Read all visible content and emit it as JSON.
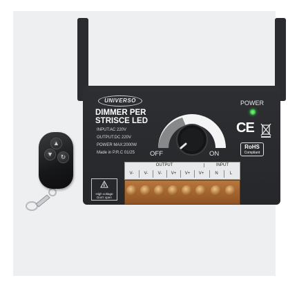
{
  "device": {
    "brand": "UNIVERSO",
    "title_line1": "DIMMER PER",
    "title_line2": "STRISCE LED",
    "specs": [
      "INPUT:AC 220V",
      "OUTPUT:DC 220V",
      "POWER MAX:2000W",
      "Made in P.R.C 01/25"
    ],
    "off_label": "OFF",
    "on_label": "ON",
    "power_label": "POWER",
    "ce_mark": "CE",
    "rohs": "RoHS",
    "rohs_sub": "Compliant",
    "terminals": {
      "output_label": "OUTPUT",
      "input_label": "INPUT",
      "cells": [
        "V-",
        "V-",
        "V-",
        "V+",
        "V+",
        "V+",
        "N",
        "L"
      ]
    },
    "warning": "High voltage Don't open"
  },
  "remote": {
    "buttons": [
      "▲",
      "▼",
      "↻"
    ]
  },
  "colors": {
    "housing": "#26282b",
    "terminal": "#a86a33",
    "led": "#3ad24e"
  }
}
